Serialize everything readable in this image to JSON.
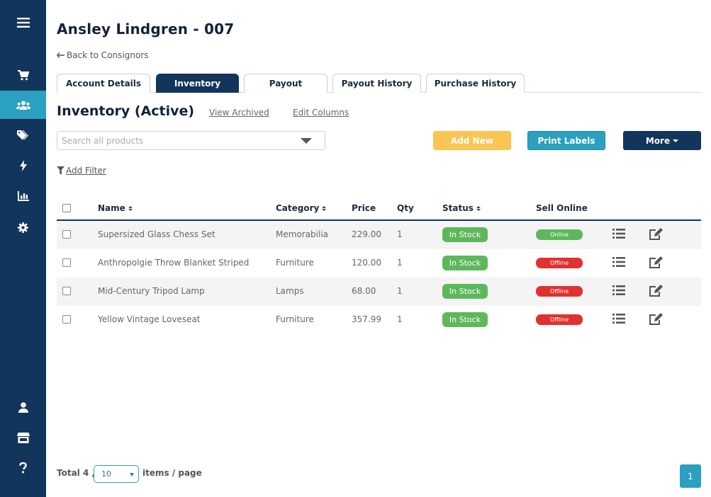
{
  "sidebar": {
    "items": [
      {
        "icon": "hamburger-menu-icon"
      },
      {
        "icon": "cart-icon"
      },
      {
        "icon": "users-icon",
        "active": true
      },
      {
        "icon": "tags-icon"
      },
      {
        "icon": "bolt-icon"
      },
      {
        "icon": "bar-chart-icon"
      },
      {
        "icon": "gear-icon"
      },
      {
        "icon": "user-icon"
      },
      {
        "icon": "store-icon"
      },
      {
        "icon": "help-icon"
      }
    ],
    "active_color": "#2ba0c0",
    "bg_color": "#12355b"
  },
  "header": {
    "title": "Ansley Lindgren - 007",
    "back_label": "Back to Consignors"
  },
  "tabs": [
    {
      "label": "Account Details"
    },
    {
      "label": "Inventory",
      "active": true
    },
    {
      "label": "Payout"
    },
    {
      "label": "Payout History"
    },
    {
      "label": "Purchase History"
    }
  ],
  "inventory": {
    "title": "Inventory (Active)",
    "view_archived": "View Archived",
    "edit_columns": "Edit Columns",
    "search_placeholder": "Search all products",
    "add_new": "Add New",
    "print_labels": "Print Labels",
    "more": "More",
    "add_filter": "Add Filter"
  },
  "table": {
    "headers": {
      "name": "Name",
      "category": "Category",
      "price": "Price",
      "qty": "Qty",
      "status": "Status",
      "sell_online": "Sell Online"
    },
    "rows": [
      {
        "name": "Supersized Glass Chess Set",
        "category": "Memorabilia",
        "price": "229.00",
        "qty": "1",
        "status": "In Stock",
        "online": "Online"
      },
      {
        "name": "Anthropolgie Throw Blanket Striped",
        "category": "Furniture",
        "price": "120.00",
        "qty": "1",
        "status": "In Stock",
        "online": "Offline"
      },
      {
        "name": "Mid-Century Tripod Lamp",
        "category": "Lamps",
        "price": "68.00",
        "qty": "1",
        "status": "In Stock",
        "online": "Offline"
      },
      {
        "name": "Yellow Vintage Loveseat",
        "category": "Furniture",
        "price": "357.99",
        "qty": "1",
        "status": "In Stock",
        "online": "Offline"
      }
    ]
  },
  "footer": {
    "total": "Total 4 ,",
    "per_page_value": "10",
    "items_label": "items / page",
    "current_page": "1"
  },
  "colors": {
    "online": "#5db85c",
    "offline": "#e03131",
    "in_stock": "#5db85c",
    "add_new": "#fcc453",
    "print_labels": "#2ba0c0",
    "more": "#12355b"
  }
}
